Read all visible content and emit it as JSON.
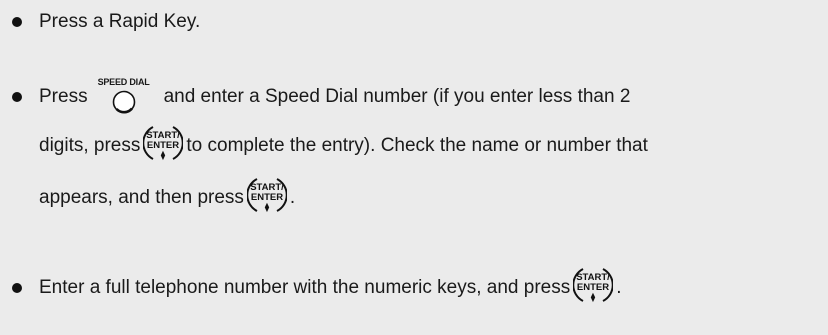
{
  "bullets": {
    "one": {
      "text": "Press a Rapid Key."
    },
    "two": {
      "pre": "Press",
      "speed_dial_label": "SPEED DIAL",
      "line1_rest": "and enter a Speed Dial number (if you enter less than 2",
      "line2_pre": "digits, press",
      "line2_post": "to complete the entry). Check the name or number that",
      "line3_pre": "appears, and then press",
      "line3_post": "."
    },
    "three": {
      "pre": "Enter a full telephone number with the numeric keys, and press",
      "post": "."
    }
  },
  "start_key": {
    "line1": "START/",
    "line2": "ENTER",
    "symbol": "⧫"
  }
}
